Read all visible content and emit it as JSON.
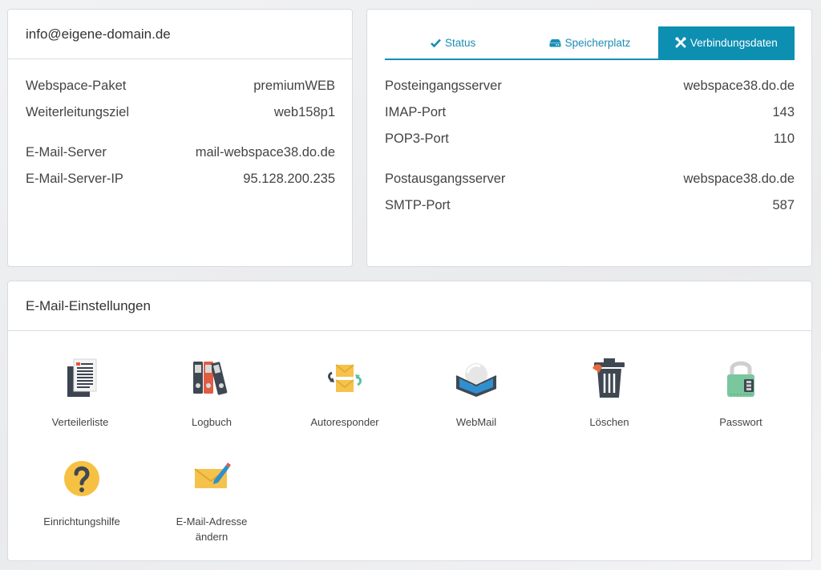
{
  "account": {
    "email": "info@eigene-domain.de",
    "rows": [
      {
        "label": "Webspace-Paket",
        "value": "premiumWEB"
      },
      {
        "label": "Weiterleitungsziel",
        "value": "web158p1"
      },
      {
        "label": "E-Mail-Server",
        "value": "mail-webspace38.do.de"
      },
      {
        "label": "E-Mail-Server-IP",
        "value": "95.128.200.235"
      }
    ]
  },
  "server": {
    "tabs": [
      {
        "label": "Status",
        "icon": "check-icon",
        "active": false
      },
      {
        "label": "Speicherplatz",
        "icon": "storage-icon",
        "active": false
      },
      {
        "label": "Verbindungsdaten",
        "icon": "tools-icon",
        "active": true
      }
    ],
    "rows": [
      {
        "label": "Posteingangsserver",
        "value": "webspace38.do.de"
      },
      {
        "label": "IMAP-Port",
        "value": "143"
      },
      {
        "label": "POP3-Port",
        "value": "110"
      },
      {
        "label": "Postausgangsserver",
        "value": "webspace38.do.de"
      },
      {
        "label": "SMTP-Port",
        "value": "587"
      }
    ]
  },
  "settings": {
    "title": "E-Mail-Einstellungen",
    "items": [
      {
        "label": "Verteilerliste",
        "icon": "document-list-icon"
      },
      {
        "label": "Logbuch",
        "icon": "binders-icon"
      },
      {
        "label": "Autoresponder",
        "icon": "envelope-swap-icon"
      },
      {
        "label": "WebMail",
        "icon": "webmail-icon"
      },
      {
        "label": "Löschen",
        "icon": "trash-icon"
      },
      {
        "label": "Passwort",
        "icon": "padlock-icon"
      },
      {
        "label": "Einrichtungshilfe",
        "icon": "help-icon"
      },
      {
        "label": "E-Mail-Adresse ändern",
        "icon": "envelope-edit-icon"
      }
    ]
  },
  "colors": {
    "accent": "#0d8fb2",
    "tab_text": "#1a8db3"
  }
}
